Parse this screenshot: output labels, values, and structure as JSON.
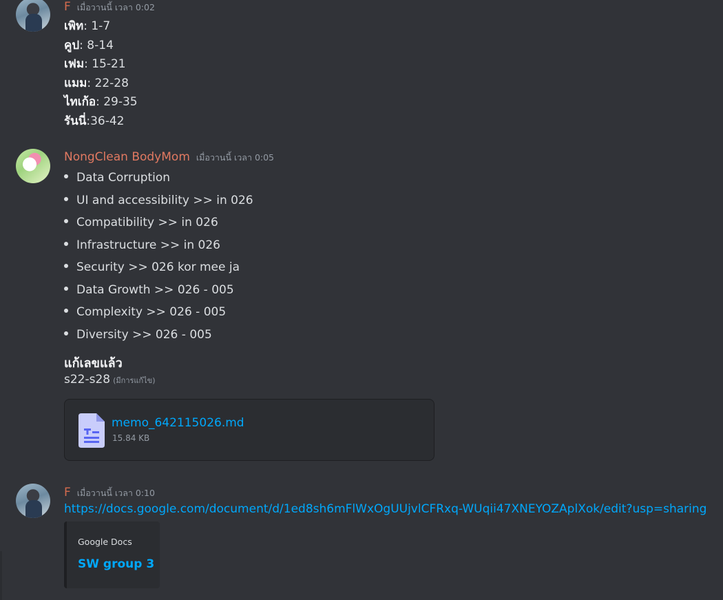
{
  "messages": [
    {
      "author": "F",
      "timestamp": "เมื่อวานนี้ เวลา 0:02",
      "lines": [
        {
          "label": "เพิท",
          "value": ": 1-7"
        },
        {
          "label": "คูป",
          "value": ": 8-14"
        },
        {
          "label": "เฟม",
          "value": ": 15-21"
        },
        {
          "label": "แมม",
          "value": ": 22-28"
        },
        {
          "label": "ไทเก้อ",
          "value": ": 29-35"
        },
        {
          "label": "รันนี่",
          "value": ":36-42"
        }
      ]
    },
    {
      "author": "NongClean BodyMom",
      "timestamp": "เมื่อวานนี้ เวลา 0:05",
      "bullets": [
        "Data Corruption",
        "UI and accessibility  >> in 026",
        "Compatibility >> in 026",
        "Infrastructure >> in 026",
        "Security >> 026 kor mee ja",
        "Data Growth >> 026 - 005",
        "Complexity >> 026 - 005",
        "Diversity >> 026 - 005"
      ],
      "heading": "แก้เลขแล้ว",
      "note": "s22-s28",
      "edited": "(มีการแก้ไข)",
      "attachment": {
        "name": "memo_642115026.md",
        "size": "15.84 KB",
        "icon": "document-icon"
      }
    },
    {
      "author": "F",
      "timestamp": "เมื่อวานนี้ เวลา 0:10",
      "link": "https://docs.google.com/document/d/1ed8sh6mFlWxOgUUjvlCFRxq-WUqii47XNEYOZAplXok/edit?usp=sharing",
      "embed": {
        "provider": "Google Docs",
        "title": "SW group 3"
      }
    }
  ],
  "colors": {
    "background": "#313338",
    "link": "#00a8fc",
    "name_f": "#d46b4e",
    "name_nc": "#e17961"
  }
}
